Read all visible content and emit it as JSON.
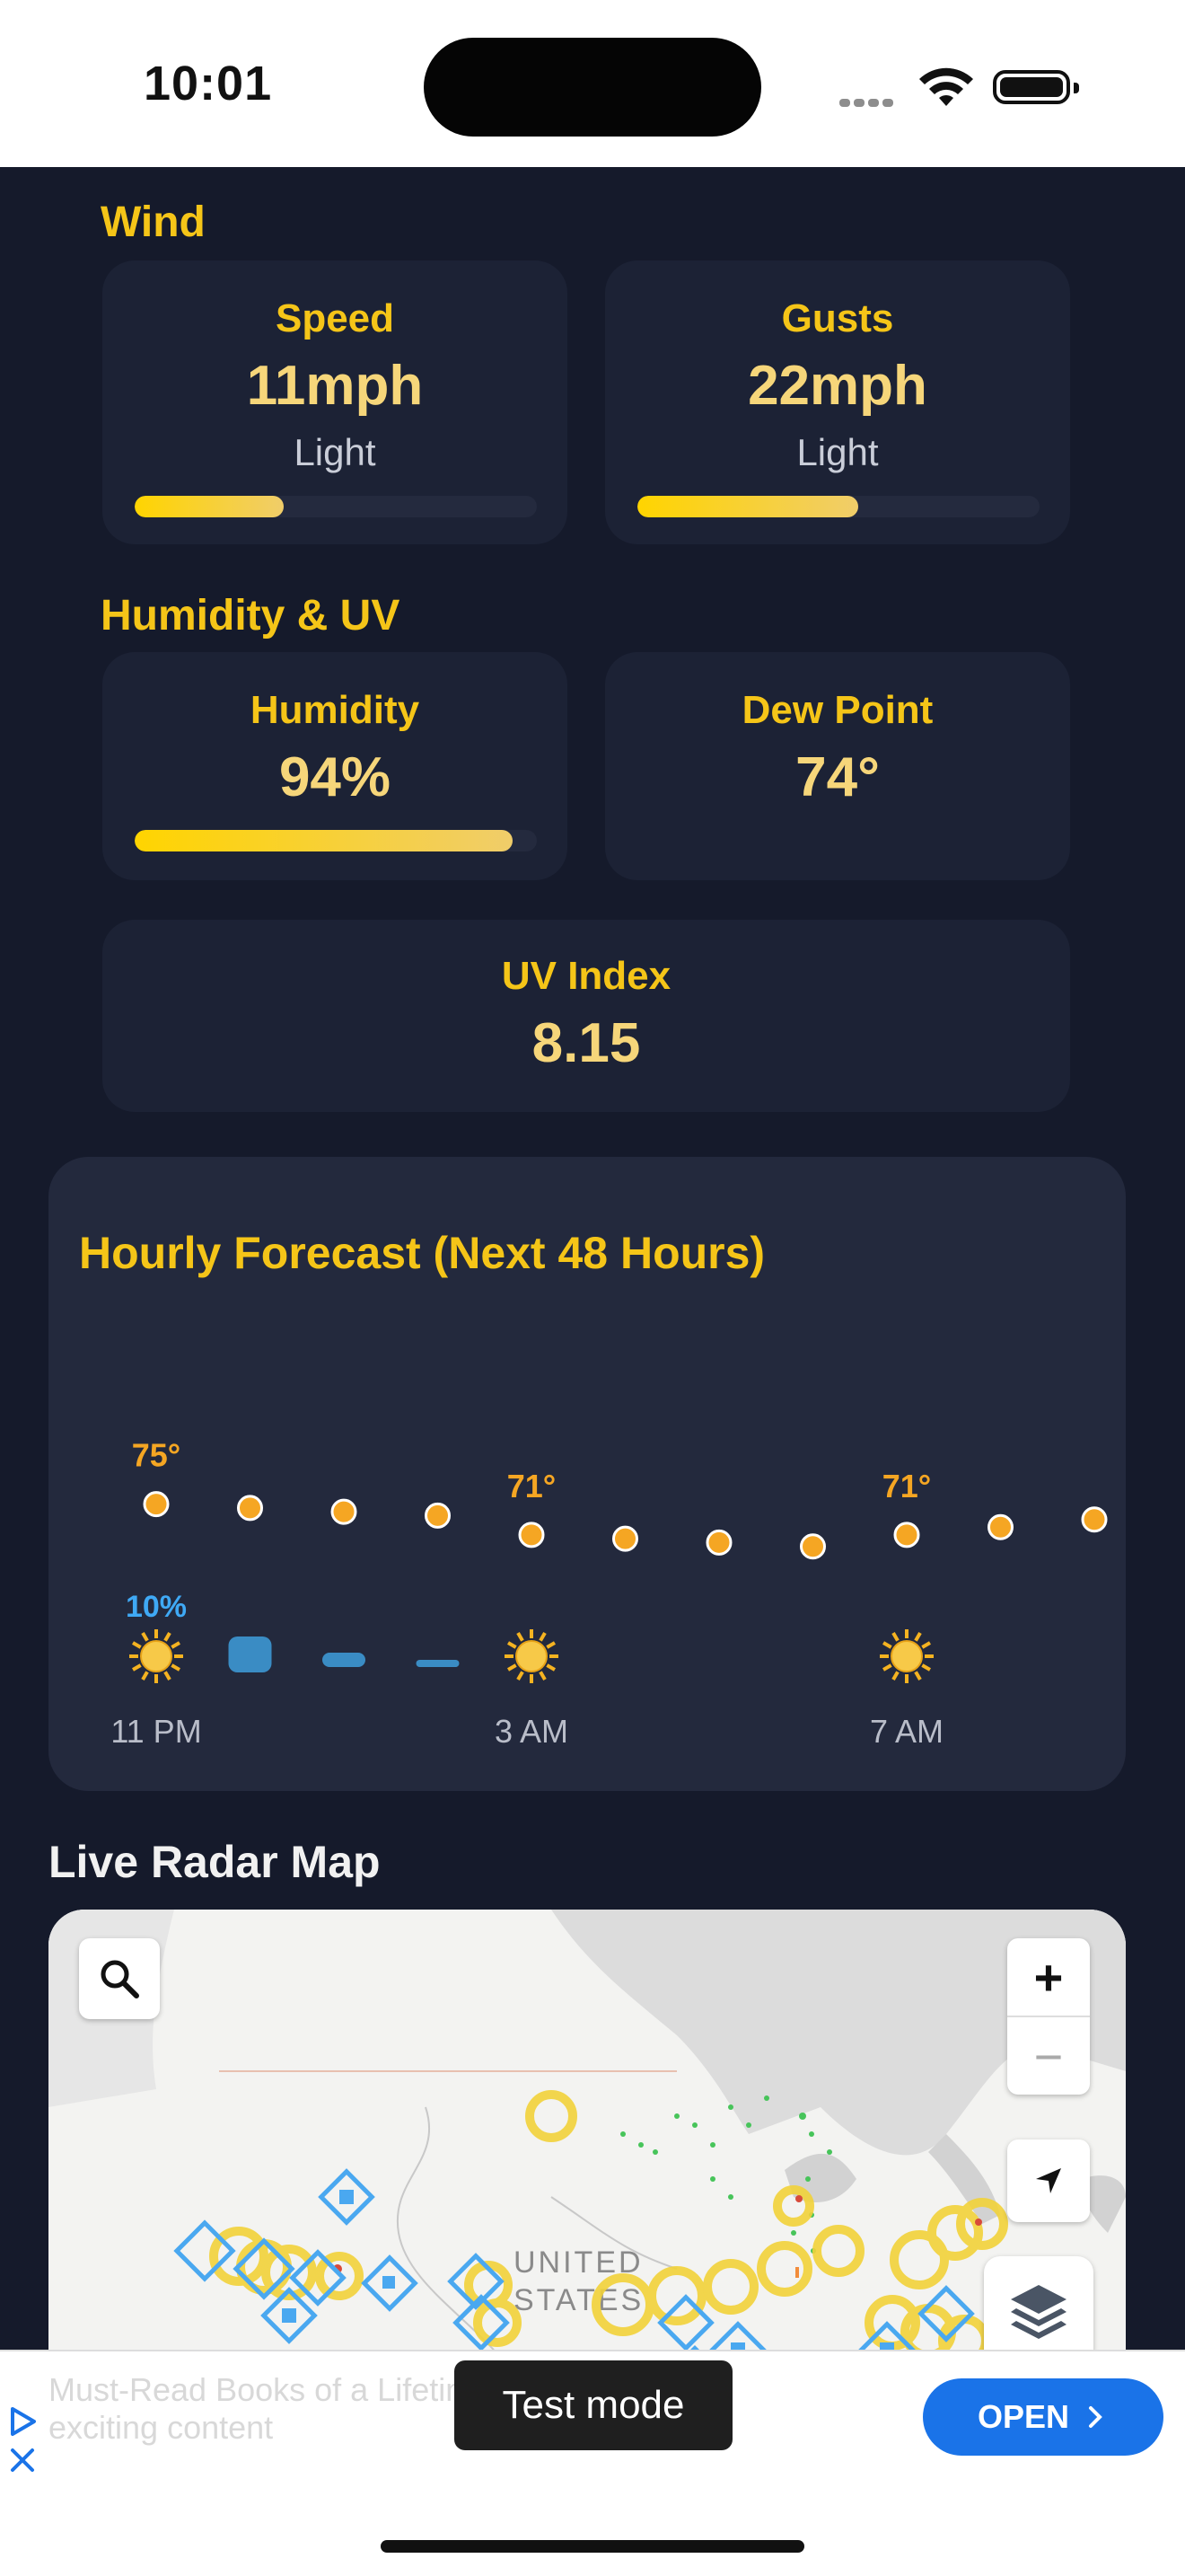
{
  "status_bar": {
    "time": "10:01"
  },
  "wind": {
    "title": "Wind",
    "speed": {
      "label": "Speed",
      "value": "11mph",
      "desc": "Light",
      "level": 0.37
    },
    "gusts": {
      "label": "Gusts",
      "value": "22mph",
      "desc": "Light",
      "level": 0.55
    }
  },
  "humidity_uv": {
    "title": "Humidity & UV",
    "humidity": {
      "label": "Humidity",
      "value": "94%",
      "level": 0.94
    },
    "dew_point": {
      "label": "Dew Point",
      "value": "74°"
    },
    "uv": {
      "label": "UV Index",
      "value": "8.15"
    }
  },
  "hourly": {
    "title": "Hourly Forecast (Next 48 Hours)",
    "temp_labels": [
      "75°",
      "71°",
      "71°"
    ],
    "precip_label": "10%",
    "time_labels": [
      "11 PM",
      "3 AM",
      "7 AM"
    ]
  },
  "chart_data": {
    "type": "scatter",
    "title": "Hourly Forecast (Next 48 Hours)",
    "x": [
      "11 PM",
      "",
      "",
      "",
      "3 AM",
      "",
      "",
      "",
      "7 AM",
      "",
      ""
    ],
    "series": [
      {
        "values": [
          75,
          74.5,
          74,
          73.5,
          71,
          70.5,
          70,
          69.5,
          71,
          72,
          73
        ]
      }
    ],
    "data_labels": [
      {
        "index": 0,
        "text": "75°"
      },
      {
        "index": 4,
        "text": "71°"
      },
      {
        "index": 8,
        "text": "71°"
      }
    ],
    "weather_icons": [
      "sun-icon",
      "cloud-rain-icon",
      "rain-light-icon",
      "rain-trace-icon",
      "sun-icon",
      "",
      "",
      "",
      "sun-icon",
      "",
      ""
    ],
    "precip": {
      "index": 0,
      "text": "10%"
    }
  },
  "radar": {
    "title": "Live Radar Map",
    "map_label": "UNITED STATES",
    "zoom_in": "+",
    "zoom_out": "−"
  },
  "ad": {
    "line1": "Must-Read Books of a Lifetime & more",
    "line2": "exciting content",
    "cta": "OPEN",
    "toast": "Test mode"
  },
  "colors": {
    "background": "#151a2b",
    "card": "#1c2235",
    "accent": "#f5c518",
    "value": "#f6d67a",
    "precip": "#3fa9f5",
    "ad_button": "#1a73e8"
  }
}
